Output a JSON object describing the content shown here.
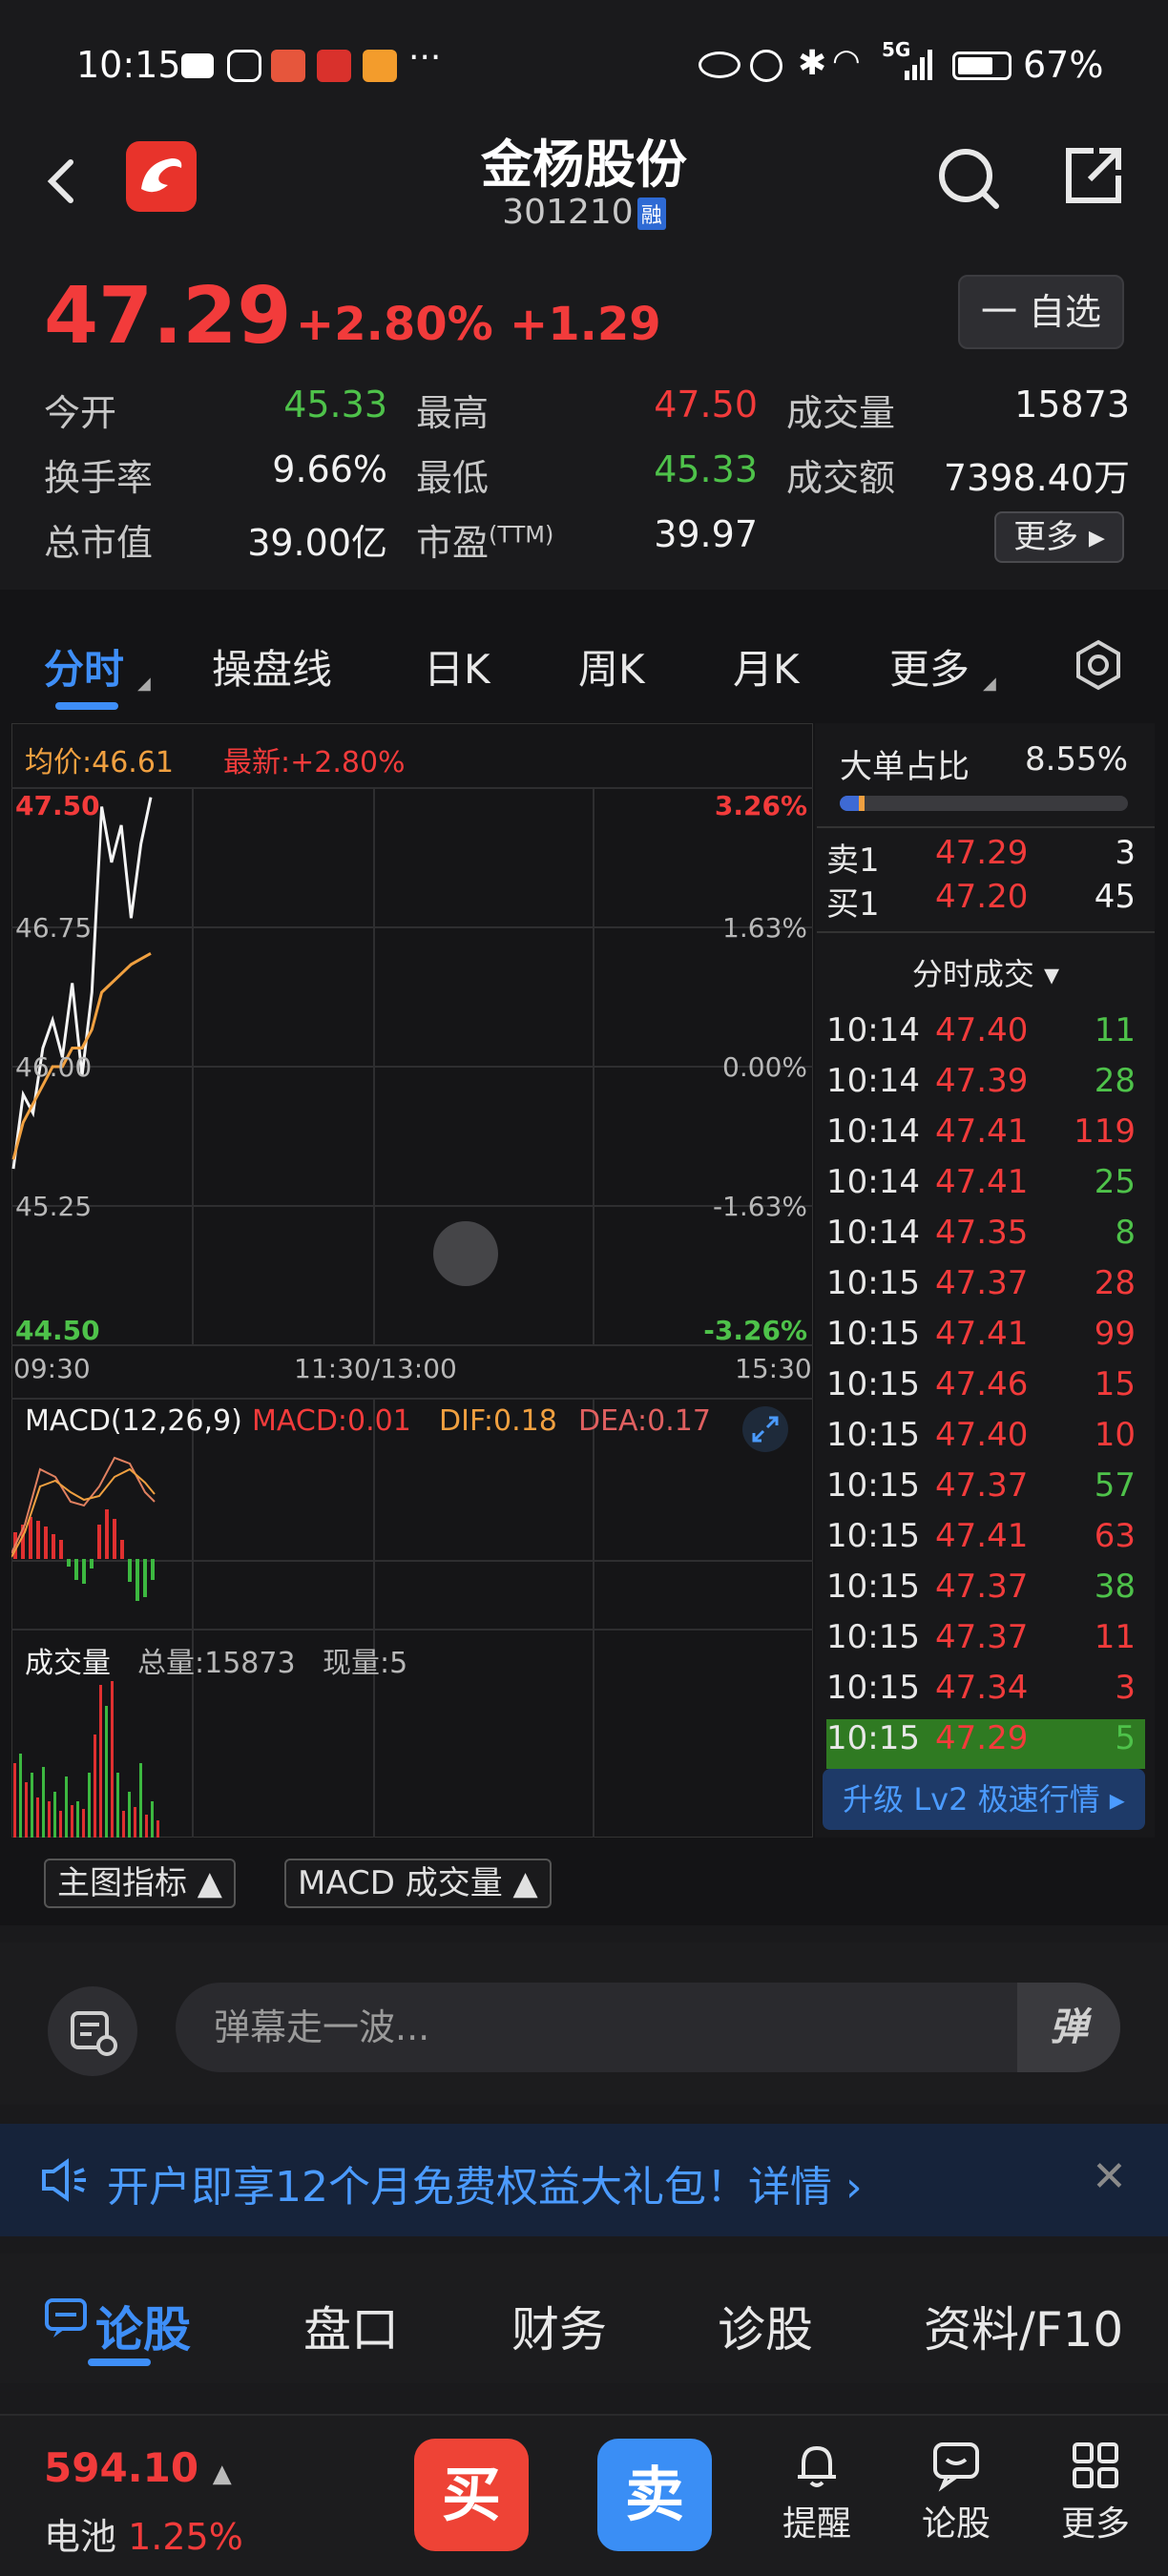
{
  "status_bar": {
    "time": "10:15",
    "right_text": "5G  67%",
    "battery": "67%"
  },
  "header": {
    "stock_name": "金杨股份",
    "stock_code": "301210",
    "code_badge": "融"
  },
  "quote": {
    "price": "47.29",
    "change_pct": "+2.80%",
    "change": "+1.29",
    "watch_label": "一 自选",
    "more_label": "更多 ▸",
    "fields": [
      {
        "label": "今开",
        "value": "45.33",
        "color": "green"
      },
      {
        "label": "最高",
        "value": "47.50",
        "color": "red"
      },
      {
        "label": "成交量",
        "value": "15873",
        "color": "white"
      },
      {
        "label": "换手率",
        "value": "9.66%",
        "color": "white"
      },
      {
        "label": "最低",
        "value": "45.33",
        "color": "green"
      },
      {
        "label": "成交额",
        "value": "7398.40万",
        "color": "white"
      },
      {
        "label": "总市值",
        "value": "39.00亿",
        "color": "white"
      },
      {
        "label": "市盈",
        "label_sup": "(TTM)",
        "value": "39.97",
        "color": "white"
      }
    ]
  },
  "chart_tabs": [
    "分时",
    "操盘线",
    "日K",
    "周K",
    "月K",
    "更多"
  ],
  "chart": {
    "avg_label": "均价:46.61",
    "latest_label": "最新:+2.80%",
    "y_labels": [
      "47.50",
      "46.75",
      "46.00",
      "45.25",
      "44.50"
    ],
    "pct_labels": [
      "3.26%",
      "1.63%",
      "0.00%",
      "-1.63%",
      "-3.26%"
    ],
    "x_labels": [
      "09:30",
      "11:30/13:00",
      "15:30"
    ],
    "macd_label": "MACD(12,26,9)",
    "macd_value": "MACD:0.01",
    "dif_value": "DIF:0.18",
    "dea_value": "DEA:0.17",
    "volume_label": "成交量",
    "total_volume": "总量:15873",
    "current_volume": "现量:5"
  },
  "chart_data": {
    "type": "line",
    "title": "",
    "xlabel": "",
    "ylabel": "",
    "ylim": [
      44.5,
      47.5
    ],
    "series": [
      {
        "name": "",
        "values": [
          45.45,
          45.85,
          45.75,
          46.1,
          46.25,
          46.05,
          46.45,
          45.95,
          46.4,
          47.4,
          47.1,
          47.3,
          46.8,
          47.2,
          47.45
        ]
      },
      {
        "name": "均价",
        "values": [
          45.5,
          45.7,
          45.8,
          45.9,
          46.0,
          46.0,
          46.1,
          46.1,
          46.2,
          46.4,
          46.45,
          46.5,
          46.55,
          46.58,
          46.61
        ]
      }
    ]
  },
  "right_panel": {
    "big_order_label": "大单占比",
    "big_order_value": "8.55%",
    "sell1": {
      "label": "卖1",
      "price": "47.29",
      "vol": "3"
    },
    "buy1": {
      "label": "买1",
      "price": "47.20",
      "vol": "45"
    },
    "ticks_header": "分时成交 ▾",
    "ticks": [
      {
        "time": "10:14",
        "price": "47.40",
        "vol": "11",
        "vcolor": "green"
      },
      {
        "time": "10:14",
        "price": "47.39",
        "vol": "28",
        "vcolor": "green"
      },
      {
        "time": "10:14",
        "price": "47.41",
        "vol": "119",
        "vcolor": "red"
      },
      {
        "time": "10:14",
        "price": "47.41",
        "vol": "25",
        "vcolor": "green"
      },
      {
        "time": "10:14",
        "price": "47.35",
        "vol": "8",
        "vcolor": "green"
      },
      {
        "time": "10:15",
        "price": "47.37",
        "vol": "28",
        "vcolor": "red"
      },
      {
        "time": "10:15",
        "price": "47.41",
        "vol": "99",
        "vcolor": "red"
      },
      {
        "time": "10:15",
        "price": "47.46",
        "vol": "15",
        "vcolor": "red"
      },
      {
        "time": "10:15",
        "price": "47.40",
        "vol": "10",
        "vcolor": "red"
      },
      {
        "time": "10:15",
        "price": "47.37",
        "vol": "57",
        "vcolor": "green"
      },
      {
        "time": "10:15",
        "price": "47.41",
        "vol": "63",
        "vcolor": "red"
      },
      {
        "time": "10:15",
        "price": "47.37",
        "vol": "38",
        "vcolor": "green"
      },
      {
        "time": "10:15",
        "price": "47.37",
        "vol": "11",
        "vcolor": "red"
      },
      {
        "time": "10:15",
        "price": "47.34",
        "vol": "3",
        "vcolor": "red"
      },
      {
        "time": "10:15",
        "price": "47.29",
        "vol": "5",
        "vcolor": "green"
      }
    ],
    "lv2_label": "升级 Lv2 极速行情 ▸"
  },
  "indicator_buttons": [
    "主图指标 ▲",
    "MACD 成交量 ▲"
  ],
  "comment": {
    "placeholder": "弹幕走一波...",
    "danmu_label": "弹"
  },
  "promo": {
    "text": "开户即享12个月免费权益大礼包！详情 ›"
  },
  "bottom_tabs": [
    "论股",
    "盘口",
    "财务",
    "诊股",
    "资料/F10"
  ],
  "footer": {
    "index_value": "594.10",
    "index_name": "电池",
    "index_pct": "1.25%",
    "buy_label": "买",
    "sell_label": "卖",
    "alert_label": "提醒",
    "discuss_label": "论股",
    "more_label": "更多"
  }
}
